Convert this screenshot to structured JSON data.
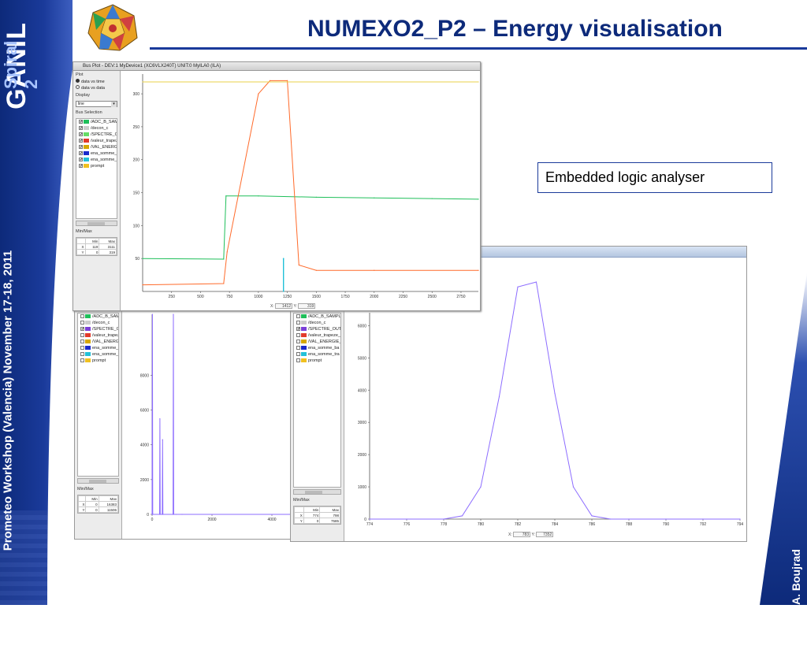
{
  "slide": {
    "title": "NUMEXO2_P2 – Energy visualisation",
    "left_vertical": "Prometeo Workshop (Valencia) November 17-18, 2011",
    "brand_main": "GANIL",
    "brand_sub": "Spiral 2",
    "author": "A. Boujrad",
    "callout": "Embedded logic analyser"
  },
  "colors": {
    "brand_blue": "#0d2a7a",
    "green_trace": "#1fbf5a",
    "orange_trace": "#ff6a2a",
    "yellow_trace": "#e8d24a",
    "purple_trace": "#8c6cff",
    "cyan_trace": "#22c0d8"
  },
  "main_window": {
    "title": "Bus Plot - DEV:1 MyDevice1 (XC6VLX240T) UNIT:0 MyILA0 (ILA)",
    "plot_section": "Plot",
    "radio_time": "data vs time",
    "radio_data": "data vs data",
    "display_section": "Display",
    "display_value": "line",
    "bus_section": "Bus Selection",
    "buses": [
      {
        "label": "/ADC_B_SAMPLE",
        "color": "#1fbf5a",
        "checked": "✔"
      },
      {
        "label": "/decon_c",
        "color": "#cccccc",
        "checked": "✔"
      },
      {
        "label": "/SPECTRE_OUT",
        "color": "#66dd66",
        "checked": "✔"
      },
      {
        "label": "/valeur_trapeze_c",
        "color": "#e23a2a",
        "checked": "✔"
      },
      {
        "label": "/VAL_ENERGIE_",
        "color": "#d6a800",
        "checked": "✔"
      },
      {
        "label": "ena_somme_ba",
        "color": "#1a2acc",
        "checked": "✔"
      },
      {
        "label": "ena_somme_tra",
        "color": "#22c0d8",
        "checked": "✔"
      },
      {
        "label": "prompt",
        "color": "#f0c020",
        "checked": "✔"
      }
    ],
    "minmax_label": "Min/Max",
    "mm_head": [
      "",
      "Min",
      "Max"
    ],
    "mm_rows": [
      [
        "X",
        "119",
        "3111"
      ],
      [
        "Y",
        "0",
        "319"
      ]
    ],
    "y_ticks": [
      "300",
      "250",
      "200",
      "150",
      "100",
      "50"
    ],
    "x_ticks": [
      "250",
      "500",
      "750",
      "1000",
      "1250",
      "1500",
      "1750",
      "2000",
      "2250",
      "2500",
      "2750"
    ],
    "x_readout_label": "X:",
    "x_readout": "1412",
    "y_readout_label": "Y:",
    "y_readout": "319"
  },
  "left_window": {
    "buses": [
      {
        "label": "/ADC_B_SAMPLE",
        "color": "#1fbf5a",
        "checked": ""
      },
      {
        "label": "/decon_c",
        "color": "#cccccc",
        "checked": ""
      },
      {
        "label": "/SPECTRE_OUT",
        "color": "#7b3fd8",
        "checked": "✔"
      },
      {
        "label": "/valeur_trapeze_c",
        "color": "#e23a2a",
        "checked": ""
      },
      {
        "label": "/VAL_ENERGIE_",
        "color": "#d6a800",
        "checked": ""
      },
      {
        "label": "ena_somme_ba",
        "color": "#1a2acc",
        "checked": ""
      },
      {
        "label": "ena_somme_tra",
        "color": "#22c0d8",
        "checked": ""
      },
      {
        "label": "prompt",
        "color": "#f0c020",
        "checked": ""
      }
    ],
    "minmax_label": "Min/Max",
    "mm_head": [
      "",
      "Min",
      "Max"
    ],
    "mm_rows": [
      [
        "X",
        "0",
        "16383"
      ],
      [
        "Y",
        "0",
        "11506"
      ]
    ],
    "y_ticks": [
      "8000",
      "6000",
      "4000",
      "2000",
      "0"
    ],
    "x_ticks": [
      "0",
      "2000",
      "4000"
    ]
  },
  "right_window": {
    "buses": [
      {
        "label": "/ADC_B_SAMPLE",
        "color": "#1fbf5a",
        "checked": ""
      },
      {
        "label": "/decon_c",
        "color": "#cccccc",
        "checked": ""
      },
      {
        "label": "/SPECTRE_OUT",
        "color": "#7b3fd8",
        "checked": "✔"
      },
      {
        "label": "/valeur_trapeze_c",
        "color": "#e23a2a",
        "checked": ""
      },
      {
        "label": "/VAL_ENERGIE_",
        "color": "#d6a800",
        "checked": ""
      },
      {
        "label": "ena_somme_ba",
        "color": "#1a2acc",
        "checked": ""
      },
      {
        "label": "ena_somme_tra",
        "color": "#22c0d8",
        "checked": ""
      },
      {
        "label": "prompt",
        "color": "#f0c020",
        "checked": ""
      }
    ],
    "minmax_label": "Min/Max",
    "mm_head": [
      "",
      "Min",
      "Max"
    ],
    "mm_rows": [
      [
        "X",
        "774",
        "798"
      ],
      [
        "Y",
        "0",
        "7585"
      ]
    ],
    "y_ticks": [
      "6000",
      "5000",
      "4000",
      "3000",
      "2000",
      "1000",
      "0"
    ],
    "x_ticks": [
      "774",
      "776",
      "778",
      "780",
      "782",
      "784",
      "786",
      "788",
      "790",
      "792",
      "794"
    ],
    "x_readout_label": "X:",
    "x_readout": "783",
    "y_readout_label": "Y:",
    "y_readout": "7352"
  },
  "chart_data": [
    {
      "type": "line",
      "note_series": [
        "/ADC_B_SAMPLE",
        "/valeur_trapeze_c",
        "/VAL_ENERGIE_",
        "ena_somme_tra"
      ],
      "ylim": [
        0,
        330
      ],
      "xlim": [
        0,
        2900
      ],
      "series": [
        {
          "name": "/ADC_B_SAMPLE",
          "x": [
            0,
            700,
            720,
            1000,
            1500,
            2000,
            2500,
            2900
          ],
          "values": [
            50,
            49,
            145,
            145,
            143,
            142,
            141,
            140
          ]
        },
        {
          "name": "/valeur_trapeze_c",
          "x": [
            0,
            700,
            730,
            1000,
            1100,
            1250,
            1350,
            1500,
            2000,
            2900
          ],
          "values": [
            10,
            12,
            60,
            300,
            320,
            320,
            40,
            32,
            32,
            32
          ]
        },
        {
          "name": "/VAL_ENERGIE_",
          "x": [
            0,
            2900
          ],
          "values": [
            318,
            318
          ]
        },
        {
          "name": "ena_somme_tra",
          "x": [
            1215,
            1215,
            1218,
            1218
          ],
          "values": [
            0,
            50,
            50,
            0
          ]
        }
      ]
    },
    {
      "type": "line",
      "ylim": [
        0,
        11506
      ],
      "xlim": [
        0,
        5000
      ],
      "series": [
        {
          "name": "/SPECTRE_OUT",
          "x": [
            0,
            10,
            20,
            250,
            260,
            270,
            340,
            350,
            360,
            700,
            710,
            720,
            800,
            1000,
            5000
          ],
          "values": [
            0,
            11500,
            0,
            0,
            5500,
            0,
            0,
            4300,
            0,
            0,
            11500,
            0,
            0,
            0,
            0
          ]
        }
      ]
    },
    {
      "type": "line",
      "ylim": [
        0,
        6400
      ],
      "xlim": [
        774,
        794
      ],
      "series": [
        {
          "name": "/SPECTRE_OUT",
          "x": [
            774,
            776,
            778,
            779,
            780,
            781,
            782,
            783,
            784,
            785,
            786,
            787,
            788,
            790,
            792,
            794
          ],
          "values": [
            0,
            0,
            0,
            100,
            1000,
            3800,
            7200,
            7352,
            3900,
            1000,
            100,
            0,
            0,
            0,
            0,
            0
          ]
        }
      ]
    }
  ]
}
